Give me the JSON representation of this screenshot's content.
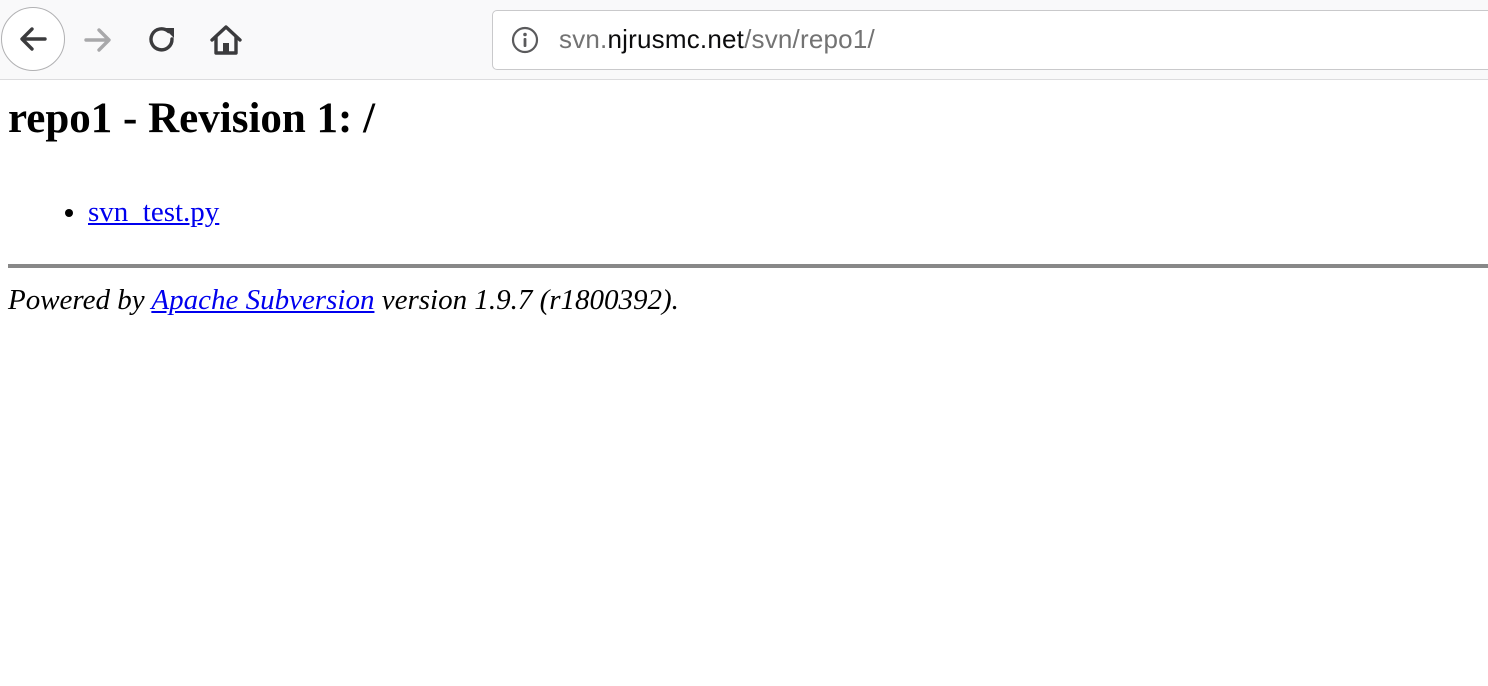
{
  "browser": {
    "icons": {
      "back": "arrow-left-icon",
      "forward": "arrow-right-icon",
      "reload": "reload-icon",
      "home": "home-icon",
      "info": "info-icon"
    },
    "url": {
      "prefix": "svn.",
      "domain": "njrusmc.net",
      "path": "/svn/repo1/"
    }
  },
  "page": {
    "title": "repo1 - Revision 1: /",
    "files": [
      {
        "name": "svn_test.py"
      }
    ],
    "footer": {
      "prefix": "Powered by ",
      "link_text": "Apache Subversion",
      "suffix": " version 1.9.7 (r1800392)."
    }
  }
}
